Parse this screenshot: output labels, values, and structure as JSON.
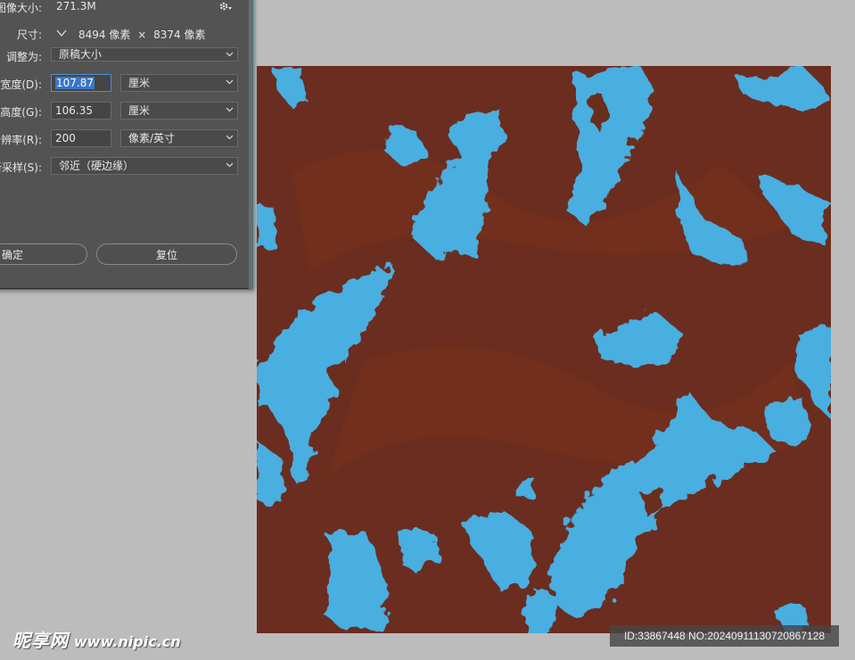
{
  "dialog": {
    "image_size_label": "图像大小:",
    "image_size_value": "271.3M",
    "dimensions_label": "尺寸:",
    "dimensions_width": "8494",
    "dimensions_unit_a": "像素",
    "dimensions_x": "×",
    "dimensions_height": "8374",
    "dimensions_unit_b": "像素",
    "fit_to_label": "调整为:",
    "fit_to_value": "原稿大小",
    "width_label": "宽度(D):",
    "width_value": "107.87",
    "width_unit": "厘米",
    "height_label": "高度(G):",
    "height_value": "106.35",
    "height_unit": "厘米",
    "resolution_label": "分辨率(R):",
    "resolution_value": "200",
    "resolution_unit": "像素/英寸",
    "resample_label": "重新采样(S):",
    "resample_value": "邻近（硬边缘）",
    "ok_label": "确定",
    "reset_label": "复位"
  },
  "canvas": {
    "base_color": "#6b2d1f",
    "accent_color": "#4aaee0"
  },
  "watermark": {
    "logo": "昵享网",
    "url": "www.nipic.cn"
  },
  "id_bar": {
    "text": "ID:33867448 NO:20240911130720867128"
  }
}
